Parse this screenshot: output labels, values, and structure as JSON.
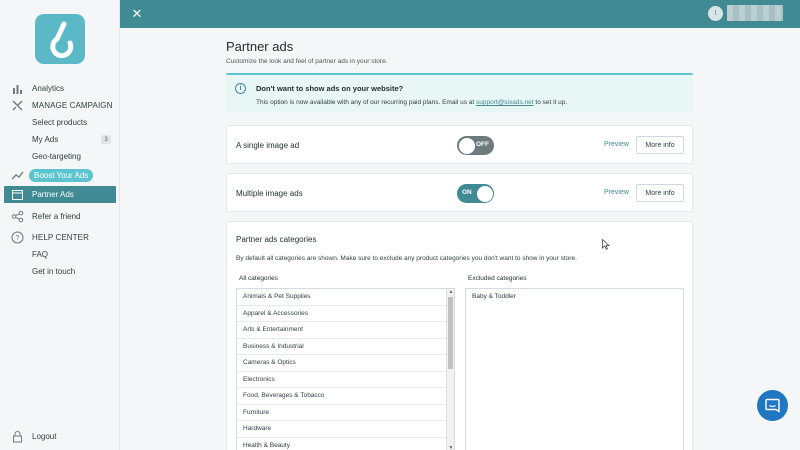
{
  "sidebar": {
    "items": [
      {
        "label": "Analytics"
      },
      {
        "label": "MANAGE CAMPAIGN"
      },
      {
        "label": "Select products"
      },
      {
        "label": "My Ads",
        "badge": "3"
      },
      {
        "label": "Geo-targeting"
      },
      {
        "label": "Boost Your Ads"
      },
      {
        "label": "Partner Ads"
      },
      {
        "label": "Refer a friend"
      },
      {
        "label": "HELP CENTER"
      },
      {
        "label": "FAQ"
      },
      {
        "label": "Get in touch"
      }
    ],
    "logout_label": "Logout"
  },
  "topbar": {
    "user_initial": "I"
  },
  "page": {
    "title": "Partner ads",
    "subtitle": "Customize the look and feel of partner ads in your store."
  },
  "info": {
    "title": "Don't want to show ads on your website?",
    "text_before": "This option is now available with any of our recurring paid plans. Email us at ",
    "email": "support@sixads.net",
    "text_after": " to set it up."
  },
  "single_ad": {
    "label": "A single image ad",
    "toggle_label": "OFF",
    "toggle_state": "off",
    "preview_label": "Preview",
    "more_info_label": "More info"
  },
  "multiple_ads": {
    "label": "Multiple image ads",
    "toggle_label": "ON",
    "toggle_state": "on",
    "preview_label": "Preview",
    "more_info_label": "More info"
  },
  "categories": {
    "title": "Partner ads categories",
    "description": "By default all categories are shown. Make sure to exclude any product categories you don't want to show in your store.",
    "all_header": "All categories",
    "excluded_header": "Excluded categories",
    "all": [
      "Animals & Pet Supplies",
      "Apparel & Accessories",
      "Arts & Entertainment",
      "Business & Industrial",
      "Cameras & Optics",
      "Electronics",
      "Food, Beverages & Tobacco",
      "Furniture",
      "Hardware",
      "Health & Beauty"
    ],
    "excluded": [
      "Baby & Toddler"
    ]
  },
  "colors": {
    "accent": "#3f8a93",
    "accent_light": "#5bc4cf",
    "chat": "#1f76c2"
  }
}
